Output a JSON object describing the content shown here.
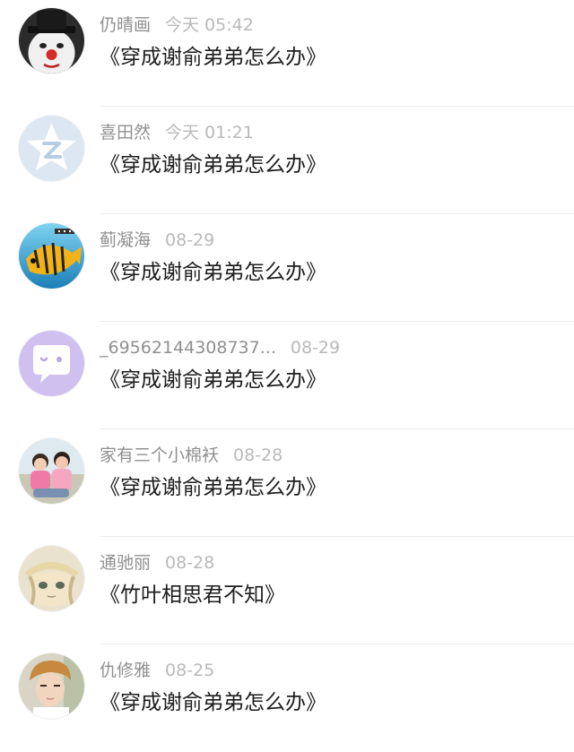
{
  "comments": [
    {
      "user": "仍晴画",
      "time": "今天 05:42",
      "title": "《穿成谢俞弟弟怎么办》",
      "avatar": "clown-avatar"
    },
    {
      "user": "喜田然",
      "time": "今天 01:21",
      "title": "《穿成谢俞弟弟怎么办》",
      "avatar": "default-z-avatar"
    },
    {
      "user": "蓟凝海",
      "time": "08-29",
      "title": "《穿成谢俞弟弟怎么办》",
      "avatar": "fish-avatar"
    },
    {
      "user": "_69562144308737...",
      "time": "08-29",
      "title": "《穿成谢俞弟弟怎么办》",
      "avatar": "chat-bubble-avatar"
    },
    {
      "user": "家有三个小棉袄",
      "time": "08-28",
      "title": "《穿成谢俞弟弟怎么办》",
      "avatar": "kids-photo-avatar"
    },
    {
      "user": "通驰丽",
      "time": "08-28",
      "title": "《竹叶相思君不知》",
      "avatar": "anime-girl-avatar"
    },
    {
      "user": "仇修雅",
      "time": "08-25",
      "title": "《穿成谢俞弟弟怎么办》",
      "avatar": "boy-photo-avatar"
    }
  ],
  "colors": {
    "username": "#909090",
    "timestamp": "#b9b9b9",
    "title": "#1d1d1d",
    "divider": "#ececec",
    "default_avatar_bg": "#dce7f2",
    "chat_avatar_bg": "#cfc0f0"
  }
}
